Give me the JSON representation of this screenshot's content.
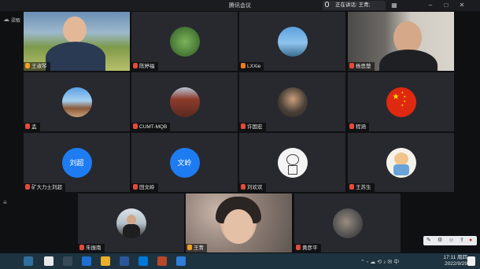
{
  "window": {
    "title": "腾讯会议"
  },
  "speaking_indicator": {
    "label": "正在讲话: 王青;"
  },
  "top_left_badge": "梁敏",
  "tiles": [
    {
      "name": "王淑琴",
      "kind": "video",
      "mic": "speak"
    },
    {
      "name": "陈婷福",
      "kind": "avatar",
      "mic": "off"
    },
    {
      "name": "LXXie",
      "kind": "avatar",
      "mic": "off"
    },
    {
      "name": "杨思楚",
      "kind": "video",
      "mic": "off"
    },
    {
      "name": "孟",
      "kind": "avatar",
      "mic": "off"
    },
    {
      "name": "CUMT-MQB",
      "kind": "avatar",
      "mic": "off"
    },
    {
      "name": "许国宏",
      "kind": "avatar",
      "mic": "off"
    },
    {
      "name": "程涵",
      "kind": "avatar",
      "mic": "off"
    },
    {
      "name": "矿大力士刘超",
      "kind": "text",
      "avatar_text": "刘超",
      "mic": "off"
    },
    {
      "name": "田文岭",
      "kind": "text",
      "avatar_text": "文岭",
      "mic": "off"
    },
    {
      "name": "刘欢欢",
      "kind": "avatar",
      "mic": "off"
    },
    {
      "name": "王苏生",
      "kind": "avatar",
      "mic": "off"
    },
    {
      "name": "朱振南",
      "kind": "avatar",
      "mic": "off"
    },
    {
      "name": "王青",
      "kind": "video",
      "mic": "speak"
    },
    {
      "name": "黄彦平",
      "kind": "avatar",
      "mic": "off"
    }
  ],
  "taskbar": {
    "time": "17:11 周四",
    "date": "2022/9/29"
  }
}
